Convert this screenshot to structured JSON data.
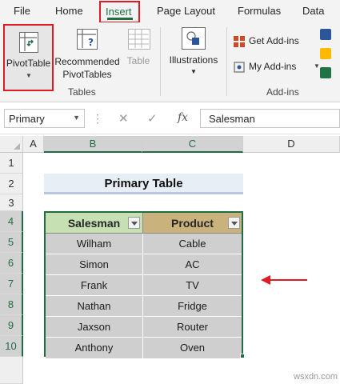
{
  "ribbon": {
    "tabs": [
      "File",
      "Home",
      "Insert",
      "Page Layout",
      "Formulas",
      "Data"
    ],
    "active_tab": "Insert",
    "groups": {
      "tables": {
        "label": "Tables",
        "pivot_table": "PivotTable",
        "recommended_line1": "Recommended",
        "recommended_line2": "PivotTables",
        "table": "Table"
      },
      "illustrations": {
        "label": "Illustrations"
      },
      "addins": {
        "label": "Add-ins",
        "get_addins": "Get Add-ins",
        "my_addins": "My Add-ins"
      }
    },
    "accent_color": "#1f6e43",
    "highlight_color": "#e01b24"
  },
  "formula_bar": {
    "name_box": "Primary",
    "fx": "fx",
    "value": "Salesman"
  },
  "grid": {
    "columns": [
      "A",
      "B",
      "C",
      "D"
    ],
    "selected_columns": [
      "B",
      "C"
    ],
    "rows": [
      "1",
      "2",
      "3",
      "4",
      "5",
      "6",
      "7",
      "8",
      "9",
      "10"
    ],
    "selected_rows": [
      "4",
      "5",
      "6",
      "7",
      "8",
      "9",
      "10"
    ]
  },
  "sheet": {
    "title": "Primary Table",
    "table": {
      "headers": [
        "Salesman",
        "Product"
      ],
      "header_colors": [
        "#c6e0b4",
        "#c9b27c"
      ],
      "rows": [
        [
          "Wilham",
          "Cable"
        ],
        [
          "Simon",
          "AC"
        ],
        [
          "Frank",
          "TV"
        ],
        [
          "Nathan",
          "Fridge"
        ],
        [
          "Jaxson",
          "Router"
        ],
        [
          "Anthony",
          "Oven"
        ]
      ]
    }
  },
  "watermark": "wsxdn.com"
}
